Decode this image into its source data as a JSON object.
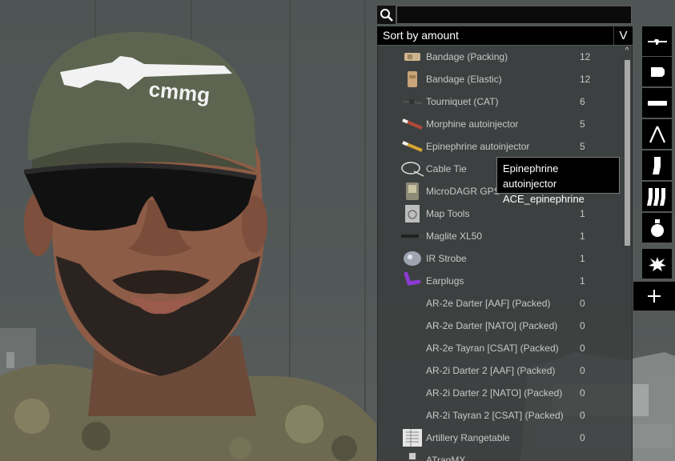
{
  "search": {
    "placeholder": "",
    "value": ""
  },
  "sort": {
    "label": "Sort by amount",
    "toggle": "V"
  },
  "items": [
    {
      "name": "Bandage (Packing)",
      "count": "12",
      "icon": "bandage-packing-icon"
    },
    {
      "name": "Bandage (Elastic)",
      "count": "12",
      "icon": "bandage-elastic-icon"
    },
    {
      "name": "Tourniquet (CAT)",
      "count": "6",
      "icon": "tourniquet-icon"
    },
    {
      "name": "Morphine autoinjector",
      "count": "5",
      "icon": "morphine-icon"
    },
    {
      "name": "Epinephrine autoinjector",
      "count": "5",
      "icon": "epinephrine-icon"
    },
    {
      "name": "Cable Tie",
      "count": "",
      "icon": "cable-tie-icon"
    },
    {
      "name": "MicroDAGR GPS",
      "count": "",
      "icon": "gps-icon"
    },
    {
      "name": "Map Tools",
      "count": "1",
      "icon": "map-tools-icon"
    },
    {
      "name": "Maglite XL50",
      "count": "1",
      "icon": "flashlight-icon"
    },
    {
      "name": "IR Strobe",
      "count": "1",
      "icon": "ir-strobe-icon"
    },
    {
      "name": "Earplugs",
      "count": "1",
      "icon": "earplugs-icon"
    },
    {
      "name": "AR-2e Darter [AAF] (Packed)",
      "count": "0",
      "icon": ""
    },
    {
      "name": "AR-2e Darter [NATO] (Packed)",
      "count": "0",
      "icon": ""
    },
    {
      "name": "AR-2e Tayran [CSAT] (Packed)",
      "count": "0",
      "icon": ""
    },
    {
      "name": "AR-2i Darter 2 [AAF] (Packed)",
      "count": "0",
      "icon": ""
    },
    {
      "name": "AR-2i Darter 2 [NATO] (Packed)",
      "count": "0",
      "icon": ""
    },
    {
      "name": "AR-2i Tayran 2 [CSAT] (Packed)",
      "count": "0",
      "icon": ""
    },
    {
      "name": "Artillery Rangetable",
      "count": "0",
      "icon": "rangetable-icon"
    },
    {
      "name": "ATragMX",
      "count": "",
      "icon": "atragmx-icon"
    }
  ],
  "tooltip": {
    "line1": "Epinephrine autoinjector",
    "line2": "ACE_epinephrine"
  },
  "tabs": [
    {
      "name": "rifle-tab",
      "icon": "rifle-icon"
    },
    {
      "name": "ammo-tab",
      "icon": "ammo-icon"
    },
    {
      "name": "muzzle-tab",
      "icon": "muzzle-icon"
    },
    {
      "name": "bipod-tab",
      "icon": "bipod-icon"
    },
    {
      "name": "magazine-tab",
      "icon": "magazine-icon"
    },
    {
      "name": "magazines-tab",
      "icon": "magazines-icon"
    },
    {
      "name": "grenade-tab",
      "icon": "grenade-icon"
    },
    {
      "name": "explosive-tab",
      "icon": "explosive-icon"
    },
    {
      "name": "misc-items-tab",
      "icon": "plus-icon"
    }
  ],
  "cap": {
    "logo_text": "cmmg"
  },
  "colors": {
    "panel": "#3a3c3c",
    "cap": "#5d6450",
    "lenses": "#111111",
    "skin": "#8a5a45"
  }
}
